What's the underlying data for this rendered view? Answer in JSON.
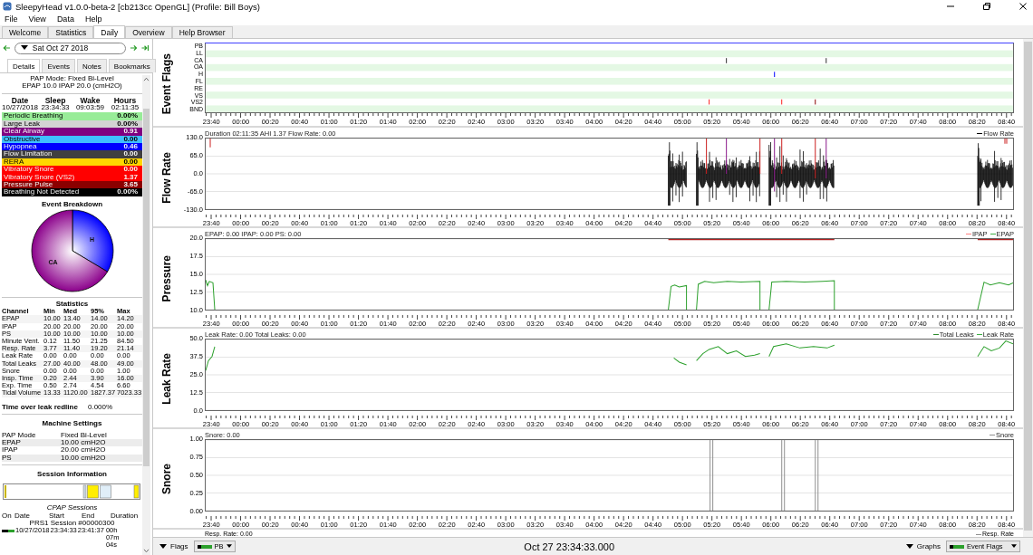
{
  "window": {
    "title": "SleepyHead v1.0.0-beta-2 [cb213cc OpenGL] (Profile: Bill Boys)"
  },
  "menu": [
    "File",
    "View",
    "Data",
    "Help"
  ],
  "tabs": [
    {
      "label": "Welcome",
      "selected": false
    },
    {
      "label": "Statistics",
      "selected": false
    },
    {
      "label": "Daily",
      "selected": true
    },
    {
      "label": "Overview",
      "selected": false
    },
    {
      "label": "Help Browser",
      "selected": false
    }
  ],
  "day_nav": {
    "date": "Sat Oct 27 2018"
  },
  "detail_tabs": [
    {
      "label": "Details",
      "selected": true
    },
    {
      "label": "Events",
      "selected": false
    },
    {
      "label": "Notes",
      "selected": false
    },
    {
      "label": "Bookmarks",
      "selected": false
    }
  ],
  "details": {
    "mode_lines": [
      "PAP Mode: Fixed Bi-Level",
      "EPAP 10.0 IPAP 20.0 (cmH2O)"
    ],
    "summary": {
      "columns": [
        "Date",
        "Sleep",
        "Wake",
        "Hours"
      ],
      "values": [
        "10/27/2018",
        "23:34:33",
        "09:03:59",
        "02:11:35"
      ]
    },
    "events": [
      {
        "name": "Periodic Breathing",
        "value": "0.00%",
        "color": "#98ec98"
      },
      {
        "name": "Large Leak",
        "value": "0.00%",
        "color": "#d3d3d3"
      },
      {
        "name": "Clear Airway",
        "value": "0.91",
        "color": "#800080"
      },
      {
        "name": "Obstructive",
        "value": "0.00",
        "color": "#40bfff"
      },
      {
        "name": "Hypopnea",
        "value": "0.46",
        "color": "#0000ff"
      },
      {
        "name": "Flow Limitation",
        "value": "0.00",
        "color": "#404040"
      },
      {
        "name": "RERA",
        "value": "0.00",
        "color": "#ffd700"
      },
      {
        "name": "Vibratory Snore",
        "value": "0.00",
        "color": "#ff0000"
      },
      {
        "name": "Vibratory Snore (VS2)",
        "value": "1.37",
        "color": "#ff0000"
      },
      {
        "name": "Pressure Pulse",
        "value": "3.65",
        "color": "#8b0000"
      },
      {
        "name": "Breathing Not Detected",
        "value": "0.00%",
        "color": "#000000"
      }
    ],
    "event_breakdown": {
      "chart_data": {
        "type": "pie",
        "title": "Event Breakdown",
        "categories": [
          "H",
          "CA"
        ],
        "values": [
          33.6,
          66.4
        ]
      }
    },
    "statistics": {
      "title": "Statistics",
      "columns": [
        "Channel",
        "Min",
        "Med",
        "95%",
        "Max"
      ],
      "rows": [
        [
          "EPAP",
          "10.00",
          "13.40",
          "14.00",
          "14.20"
        ],
        [
          "IPAP",
          "20.00",
          "20.00",
          "20.00",
          "20.00"
        ],
        [
          "PS",
          "10.00",
          "10.00",
          "10.00",
          "10.00"
        ],
        [
          "Minute Vent.",
          "0.12",
          "11.50",
          "21.25",
          "84.50"
        ],
        [
          "Resp. Rate",
          "3.77",
          "11.40",
          "19.20",
          "21.14"
        ],
        [
          "Leak Rate",
          "0.00",
          "0.00",
          "0.00",
          "0.00"
        ],
        [
          "Total Leaks",
          "27.00",
          "40.00",
          "48.00",
          "49.00"
        ],
        [
          "Snore",
          "0.00",
          "0.00",
          "0.00",
          "1.00"
        ],
        [
          "Insp. Time",
          "0.20",
          "2.44",
          "3.90",
          "16.00"
        ],
        [
          "Exp. Time",
          "0.50",
          "2.74",
          "4.54",
          "6.60"
        ],
        [
          "Tidal Volume",
          "13.33",
          "1120.00",
          "1827.37",
          "7023.33"
        ]
      ]
    },
    "leak_redline": {
      "label": "Time over leak redline",
      "value": "0.000%"
    },
    "machine_settings": {
      "title": "Machine Settings",
      "rows": [
        [
          "PAP Mode",
          "Fixed Bi-Level"
        ],
        [
          "EPAP",
          "10.00 cmH2O"
        ],
        [
          "IPAP",
          "20.00 cmH2O"
        ],
        [
          "PS",
          "10.00 cmH2O"
        ]
      ]
    },
    "session_information": {
      "title": "Session Information"
    },
    "cpap_sessions": {
      "title": "CPAP Sessions",
      "columns": [
        "On",
        "Date",
        "Start",
        "End",
        "Duration"
      ],
      "group": "PRS1 Session #00000300",
      "rows": [
        {
          "on": true,
          "date": "10/27/2018",
          "start": "23:34:33",
          "end": "23:41:37",
          "duration": "00h 07m 04s"
        }
      ]
    }
  },
  "graphs": [
    {
      "kind": "flags",
      "title": "Event Flags",
      "flags": [
        "PB",
        "LL",
        "CA",
        "OA",
        "H",
        "FL",
        "RE",
        "VS",
        "VS2",
        "BND"
      ],
      "x_ticks": [
        "23:40",
        "00:00",
        "00:20",
        "00:40",
        "01:00",
        "01:20",
        "01:40",
        "02:00",
        "02:20",
        "02:40",
        "03:00",
        "03:20",
        "03:40",
        "04:00",
        "04:20",
        "04:40",
        "05:00",
        "05:20",
        "05:40",
        "06:00",
        "06:20",
        "06:40",
        "07:00",
        "07:20",
        "07:40",
        "08:00",
        "08:20",
        "08:40"
      ]
    },
    {
      "kind": "flow",
      "title": "Flow Rate",
      "header": "Duration 02:11:35 AHI 1.37 Flow Rate: 0.00",
      "legend": [
        {
          "label": "Flow Rate",
          "color": "#000000"
        }
      ],
      "y_ticks": [
        "130.0",
        "65.0",
        "0.0",
        "-65.0",
        "-130.0"
      ],
      "x_ticks": [
        "23:40",
        "00:00",
        "00:20",
        "00:40",
        "01:00",
        "01:20",
        "01:40",
        "02:00",
        "02:20",
        "02:40",
        "03:00",
        "03:20",
        "03:40",
        "04:00",
        "04:20",
        "04:40",
        "05:00",
        "05:20",
        "05:40",
        "06:00",
        "06:20",
        "06:40",
        "07:00",
        "07:20",
        "07:40",
        "08:00",
        "08:20",
        "08:40"
      ]
    },
    {
      "kind": "pressure",
      "title": "Pressure",
      "header": "EPAP: 0.00 IPAP: 0.00 PS: 0.00",
      "legend": [
        {
          "label": "IPAP",
          "color": "#ff8080"
        },
        {
          "label": "EPAP",
          "color": "#3cb043"
        }
      ],
      "y_ticks": [
        "20.0",
        "17.5",
        "15.0",
        "12.5",
        "10.0"
      ],
      "x_ticks": [
        "23:40",
        "00:00",
        "00:20",
        "00:40",
        "01:00",
        "01:20",
        "01:40",
        "02:00",
        "02:20",
        "02:40",
        "03:00",
        "03:20",
        "03:40",
        "04:00",
        "04:20",
        "04:40",
        "05:00",
        "05:20",
        "05:40",
        "06:00",
        "06:20",
        "06:40",
        "07:00",
        "07:20",
        "07:40",
        "08:00",
        "08:20",
        "08:40"
      ]
    },
    {
      "kind": "leak",
      "title": "Leak Rate",
      "header": "Leak Rate: 0.00 Total Leaks: 0.00",
      "legend": [
        {
          "label": "Total Leaks",
          "color": "#2e8b2e"
        },
        {
          "label": "Leak Rate",
          "color": "#3cb043"
        }
      ],
      "y_ticks": [
        "50.0",
        "37.5",
        "25.0",
        "12.5",
        "0.0"
      ],
      "x_ticks": [
        "23:40",
        "00:00",
        "00:20",
        "00:40",
        "01:00",
        "01:20",
        "01:40",
        "02:00",
        "02:20",
        "02:40",
        "03:00",
        "03:20",
        "03:40",
        "04:00",
        "04:20",
        "04:40",
        "05:00",
        "05:20",
        "05:40",
        "06:00",
        "06:20",
        "06:40",
        "07:00",
        "07:20",
        "07:40",
        "08:00",
        "08:20",
        "08:40"
      ]
    },
    {
      "kind": "snore",
      "title": "Snore",
      "header": "Snore: 0.00",
      "legend": [
        {
          "label": "Snore",
          "color": "#909090"
        }
      ],
      "y_ticks": [
        "1.00",
        "0.75",
        "0.50",
        "0.25",
        "0.00"
      ],
      "x_ticks": [
        "23:40",
        "00:00",
        "00:20",
        "00:40",
        "01:00",
        "01:20",
        "01:40",
        "02:00",
        "02:20",
        "02:40",
        "03:00",
        "03:20",
        "03:40",
        "04:00",
        "04:20",
        "04:40",
        "05:00",
        "05:20",
        "05:40",
        "06:00",
        "06:20",
        "06:40",
        "07:00",
        "07:20",
        "07:40",
        "08:00",
        "08:20",
        "08:40"
      ]
    }
  ],
  "partial_graph": {
    "header": "Resp. Rate: 0.00",
    "legend": [
      {
        "label": "Resp. Rate",
        "color": "#909090"
      }
    ]
  },
  "bottom_bar": {
    "flags_button": "Flags",
    "flags_select": "PB",
    "time": "Oct 27 23:34:33.000",
    "graphs_button": "Graphs",
    "graphs_select": "Event Flags"
  }
}
